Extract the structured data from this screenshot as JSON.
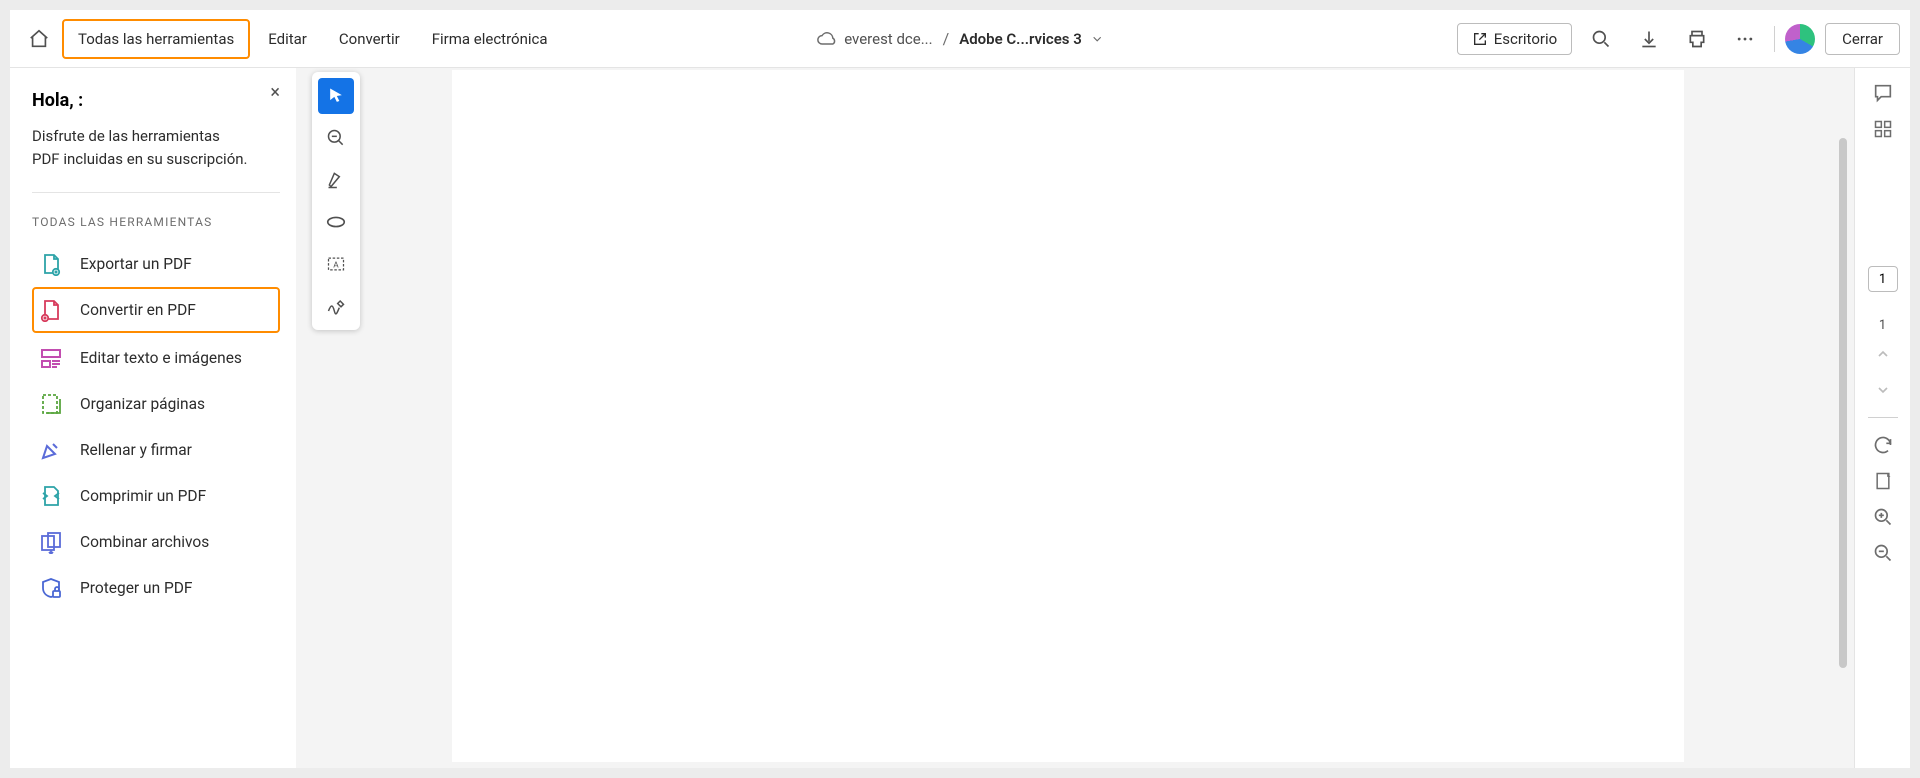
{
  "topbar": {
    "tabs": {
      "all_tools": "Todas las herramientas",
      "edit": "Editar",
      "convert": "Convertir",
      "esign": "Firma electrónica"
    },
    "cloud_label": "everest dce...",
    "breadcrumb_sep": "/",
    "doc_title": "Adobe C...rvices 3",
    "desktop": "Escritorio",
    "close": "Cerrar"
  },
  "sidebar": {
    "greeting": "Hola, :",
    "subtitle": "Disfrute de las herramientas PDF incluidas en su suscripción.",
    "section": "TODAS LAS HERRAMIENTAS",
    "items": [
      {
        "label": "Exportar un PDF"
      },
      {
        "label": "Convertir en PDF"
      },
      {
        "label": "Editar texto e imágenes"
      },
      {
        "label": "Organizar páginas"
      },
      {
        "label": "Rellenar y firmar"
      },
      {
        "label": "Comprimir un PDF"
      },
      {
        "label": "Combinar archivos"
      },
      {
        "label": "Proteger un PDF"
      }
    ]
  },
  "right_rail": {
    "current_page": "1",
    "total_pages": "1"
  }
}
